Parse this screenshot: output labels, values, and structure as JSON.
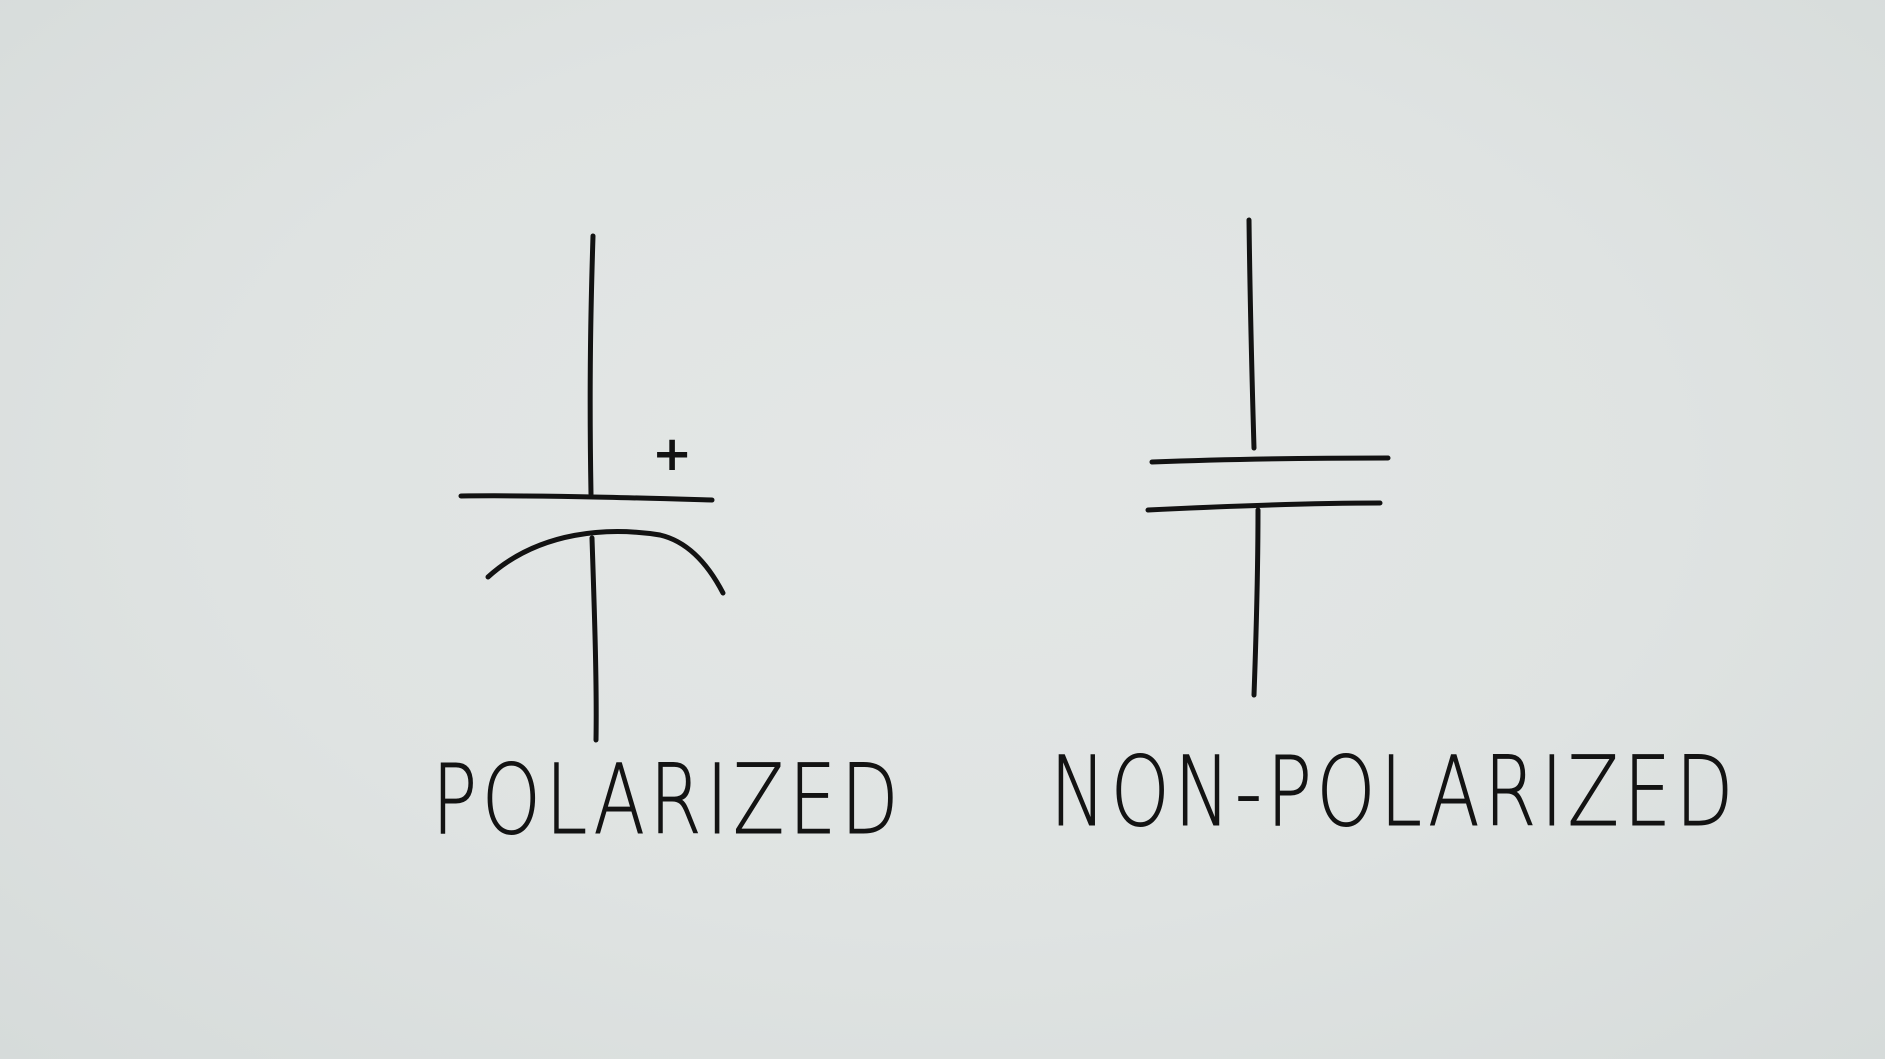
{
  "symbols": {
    "polarized": {
      "label": "POLARIZED",
      "polarity_mark": "+"
    },
    "non_polarized": {
      "label": "NON-POLARIZED"
    }
  },
  "colors": {
    "ink": "#121212",
    "background": "#dfe3e2"
  }
}
